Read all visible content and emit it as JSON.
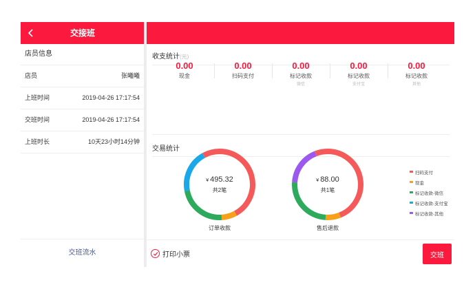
{
  "header": {
    "title": "交接班",
    "back_icon": "chevron-left-icon"
  },
  "staff": {
    "section_title": "店员信息",
    "rows": [
      {
        "label": "店员",
        "value": "张曦曦"
      },
      {
        "label": "上班时间",
        "value": "2019-04-26 17:17:54"
      },
      {
        "label": "交班时间",
        "value": "2019-04-26 17:17:54"
      },
      {
        "label": "上班时长",
        "value": "10天23小时14分钟"
      }
    ],
    "footer_link": "交班流水"
  },
  "income": {
    "section_title": "收支统计",
    "unit": "(元)",
    "stats": [
      {
        "value": "0.00",
        "label": "现金",
        "sub": ""
      },
      {
        "value": "0.00",
        "label": "扫码支付",
        "sub": ""
      },
      {
        "value": "0.00",
        "label": "标记收款",
        "sub": "微信"
      },
      {
        "value": "0.00",
        "label": "标记收款",
        "sub": "支付宝"
      },
      {
        "value": "0.00",
        "label": "标记收款",
        "sub": "其他"
      }
    ]
  },
  "transactions": {
    "section_title": "交易统计",
    "charts": [
      {
        "currency": "¥",
        "amount": "495.32",
        "count": "共2笔",
        "label": "订单收款",
        "segments": [
          {
            "color": "#f55a5a",
            "share": 0.42
          },
          {
            "color": "#f7a11a",
            "share": 0.07
          },
          {
            "color": "#2eaa5c",
            "share": 0.23
          },
          {
            "color": "#1aa8e8",
            "share": 0.2
          },
          {
            "color": "#f55a5a",
            "share": 0.08
          }
        ]
      },
      {
        "currency": "¥",
        "amount": "88.00",
        "count": "共1笔",
        "label": "售后退款",
        "segments": [
          {
            "color": "#f55a5a",
            "share": 0.44
          },
          {
            "color": "#f7a11a",
            "share": 0.07
          },
          {
            "color": "#2eaa5c",
            "share": 0.25
          },
          {
            "color": "#9b59f0",
            "share": 0.18
          },
          {
            "color": "#f55a5a",
            "share": 0.06
          }
        ]
      }
    ],
    "legend": [
      {
        "label": "扫码支付",
        "color": "#f55a5a"
      },
      {
        "label": "现金",
        "color": "#f7a11a"
      },
      {
        "label": "标记收款-微信",
        "color": "#2eaa5c"
      },
      {
        "label": "标记收款-支付宝",
        "color": "#1aa8e8"
      },
      {
        "label": "标记收款-其他",
        "color": "#9b59f0"
      }
    ]
  },
  "bottom": {
    "print_label": "打印小票",
    "handover_button": "交班"
  }
}
